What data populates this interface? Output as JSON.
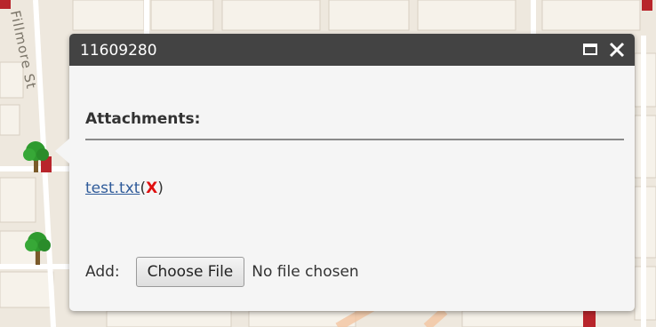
{
  "map": {
    "street_label": "Fillmore St"
  },
  "popup": {
    "title": "11609280",
    "maximize_icon": "maximize-icon",
    "close_icon": "close-icon",
    "attachments_header": "Attachments:",
    "attachments": [
      {
        "name": "test.txt",
        "open_paren": "(",
        "delete_label": "X",
        "close_paren": ")"
      }
    ],
    "add_label": "Add:",
    "choose_file_label": "Choose File",
    "no_file_text": "No file chosen"
  },
  "colors": {
    "titlebar": "#434343",
    "link": "#2f5b9a",
    "delete": "#e01010"
  }
}
